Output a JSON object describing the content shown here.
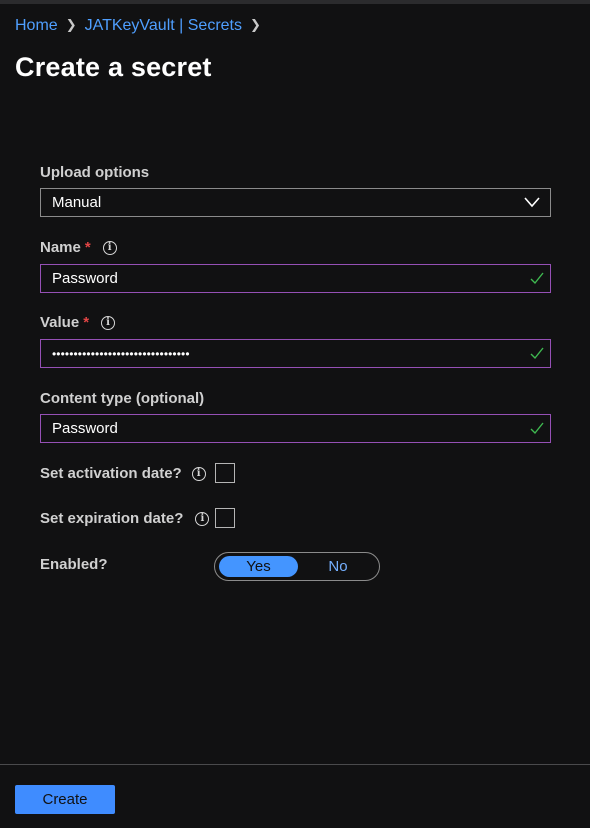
{
  "breadcrumb": {
    "items": [
      "Home",
      "JATKeyVault | Secrets"
    ]
  },
  "page_title": "Create a secret",
  "form": {
    "upload_options": {
      "label": "Upload options",
      "value": "Manual"
    },
    "name": {
      "label": "Name",
      "required_mark": "*",
      "value": "Password"
    },
    "value": {
      "label": "Value",
      "required_mark": "*",
      "masked_value": "••••••••••••••••••••••••••••••••"
    },
    "content_type": {
      "label": "Content type (optional)",
      "value": "Password"
    },
    "activation_date": {
      "label": "Set activation date?",
      "checked": false
    },
    "expiration_date": {
      "label": "Set expiration date?",
      "checked": false
    },
    "enabled": {
      "label": "Enabled?",
      "options": [
        "Yes",
        "No"
      ],
      "selected": "Yes"
    }
  },
  "footer": {
    "create_label": "Create"
  },
  "colors": {
    "accent": "#4495ff",
    "valid_border": "#9550b5",
    "check": "#3fb950",
    "required": "#e34545",
    "background": "#111112"
  }
}
